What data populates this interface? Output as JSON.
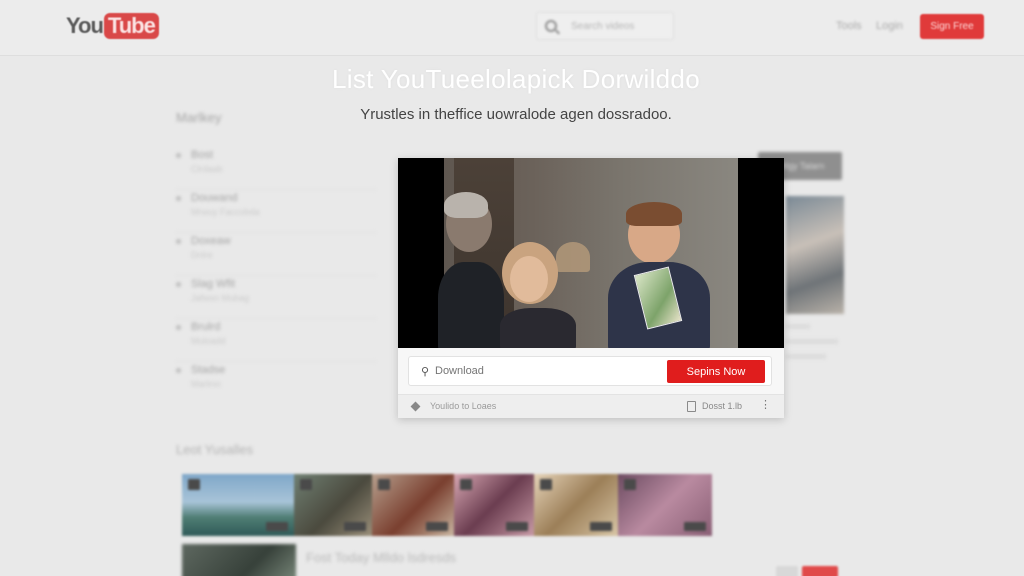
{
  "header": {
    "logo_text": "You",
    "logo_box_text": "Tube",
    "search_placeholder": "Search videos",
    "nav_links": [
      "Tools",
      "Login"
    ],
    "signup_label": "Sign Free"
  },
  "hero": {
    "title": "List YouTueelolapick Dorwilddo",
    "subtitle": "Yrustles in theffice uowralode agen dossradoo."
  },
  "sidebar": {
    "heading": "Marlkey",
    "items": [
      {
        "label": "Bost",
        "meta": "Clrdaab"
      },
      {
        "label": "Douwand",
        "meta": "Mrwuy Faccobda"
      },
      {
        "label": "Doxeaw",
        "meta": "Dnlre"
      },
      {
        "label": "Slag Wfit",
        "meta": "Jafwsn Mubag"
      },
      {
        "label": "Brulrd",
        "meta": "Muloadd"
      },
      {
        "label": "Stadse",
        "meta": "Marlmn"
      }
    ]
  },
  "right_panel": {
    "button_label": "Sitlgy Talarn"
  },
  "modal": {
    "download_placeholder": "Download",
    "start_label": "Sepins Now",
    "footer_left": "Youlido to Loaes",
    "footer_right": "Dosst 1.lb"
  },
  "gallery": {
    "heading": "Leot Yusalles",
    "row2_title": "Fost Today Mlldo lsdresds"
  },
  "colors": {
    "brand_red": "#e01d1d",
    "background": "#e9e9e9"
  }
}
